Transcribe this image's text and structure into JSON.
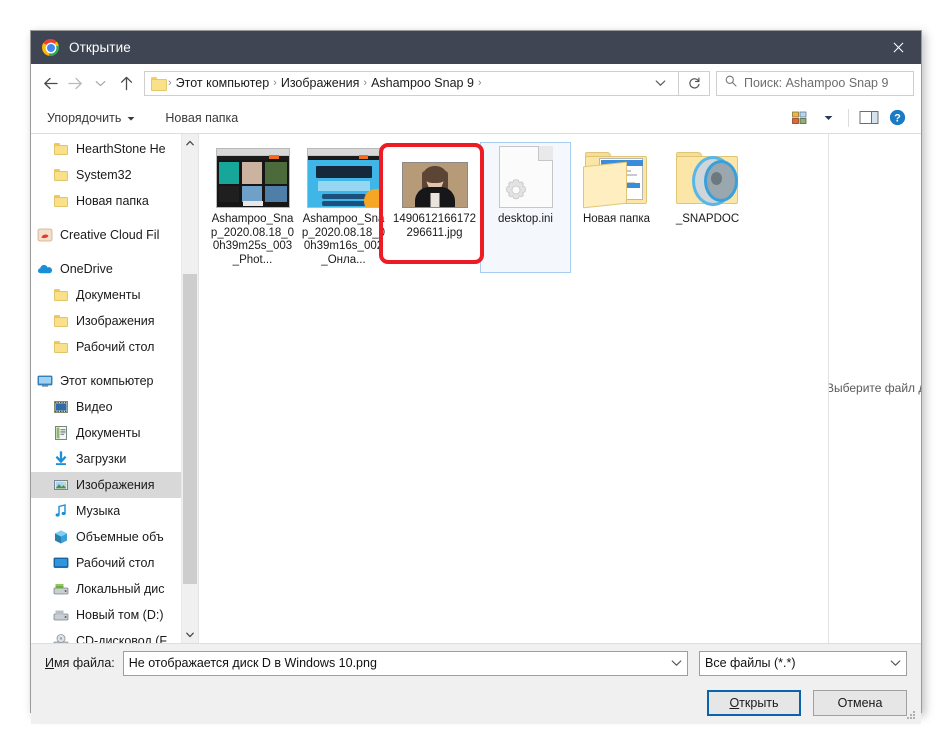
{
  "window": {
    "title": "Открытие",
    "title_icon": "chrome-icon",
    "close_icon": "close-icon"
  },
  "nav": {
    "back_icon": "arrow-left-icon",
    "forward_icon": "arrow-right-icon",
    "history_icon": "chevron-down-icon",
    "up_icon": "arrow-up-icon",
    "refresh_icon": "refresh-icon",
    "breadcrumb_icon": "folder-icon",
    "breadcrumb": [
      "Этот компьютер",
      "Изображения",
      "Ashampoo Snap 9"
    ],
    "breadcrumb_caret": "chevron-down-icon",
    "separator": "›"
  },
  "search": {
    "icon": "search-icon",
    "placeholder": "Поиск: Ashampoo Snap 9",
    "value": ""
  },
  "toolbar": {
    "organize_label": "Упорядочить",
    "organize_caret": "chevron-down-icon",
    "new_folder_label": "Новая папка",
    "view_icon": "view-layout-icon",
    "view_caret": "chevron-down-icon",
    "preview_pane_icon": "preview-pane-icon",
    "help_icon": "help-icon"
  },
  "sidebar": {
    "items": [
      {
        "label": "HearthStone  He",
        "icon": "folder-icon",
        "indent": 1,
        "selected": false
      },
      {
        "label": "System32",
        "icon": "folder-icon",
        "indent": 1,
        "selected": false
      },
      {
        "label": "Новая папка",
        "icon": "folder-icon",
        "indent": 1,
        "selected": false
      },
      {
        "label": "Creative Cloud Fil",
        "icon": "creative-cloud-icon",
        "indent": 0,
        "selected": false
      },
      {
        "label": "OneDrive",
        "icon": "onedrive-cloud-icon",
        "indent": 0,
        "selected": false
      },
      {
        "label": "Документы",
        "icon": "folder-icon",
        "indent": 1,
        "selected": false
      },
      {
        "label": "Изображения",
        "icon": "folder-icon",
        "indent": 1,
        "selected": false
      },
      {
        "label": "Рабочий стол",
        "icon": "folder-icon",
        "indent": 1,
        "selected": false
      },
      {
        "label": "Этот компьютер",
        "icon": "this-pc-icon",
        "indent": 0,
        "selected": false
      },
      {
        "label": "Видео",
        "icon": "video-folder-icon",
        "indent": 1,
        "selected": false
      },
      {
        "label": "Документы",
        "icon": "documents-folder-icon",
        "indent": 1,
        "selected": false
      },
      {
        "label": "Загрузки",
        "icon": "downloads-icon",
        "indent": 1,
        "selected": false
      },
      {
        "label": "Изображения",
        "icon": "pictures-folder-icon",
        "indent": 1,
        "selected": true
      },
      {
        "label": "Музыка",
        "icon": "music-note-icon",
        "indent": 1,
        "selected": false
      },
      {
        "label": "Объемные объ",
        "icon": "3d-objects-icon",
        "indent": 1,
        "selected": false
      },
      {
        "label": "Рабочий стол",
        "icon": "desktop-icon",
        "indent": 1,
        "selected": false
      },
      {
        "label": "Локальный дис",
        "icon": "hard-drive-icon",
        "indent": 1,
        "selected": false
      },
      {
        "label": "Новый том (D:)",
        "icon": "hard-drive-icon",
        "indent": 1,
        "selected": false
      },
      {
        "label": "CD-дисковод (F",
        "icon": "cd-drive-icon",
        "indent": 1,
        "selected": false
      }
    ],
    "scroll_up_icon": "chevron-up-icon",
    "scroll_down_icon": "chevron-down-icon"
  },
  "files": [
    {
      "name": "Ashampoo_Snap_2020.08.18_00h39m25s_003_Phot...",
      "thumb": "screenshot-dark-thumbnail",
      "selected": false,
      "annotated": false
    },
    {
      "name": "Ashampoo_Snap_2020.08.18_00h39m16s_002_Онла...",
      "thumb": "screenshot-blue-thumbnail",
      "selected": false,
      "annotated": false
    },
    {
      "name": "1490612166172296611.jpg",
      "thumb": "portrait-photo-thumbnail",
      "selected": false,
      "annotated": true
    },
    {
      "name": "desktop.ini",
      "thumb": "ini-file-icon",
      "selected": true,
      "annotated": false
    },
    {
      "name": "Новая папка",
      "thumb": "folder-with-document-icon",
      "selected": false,
      "annotated": false
    },
    {
      "name": "_SNAPDOC",
      "thumb": "folder-snapdoc-icon",
      "selected": false,
      "annotated": false
    }
  ],
  "preview": {
    "text": "Выберите файл для предварительного просмотра."
  },
  "footer": {
    "filename_label_prefix": "И",
    "filename_label_rest": "мя файла:",
    "filename_value": "Не отображается диск D в Windows 10.png",
    "filename_caret": "chevron-down-icon",
    "filetype_value": "Все файлы (*.*)",
    "filetype_caret": "chevron-down-icon",
    "open_label_prefix": "О",
    "open_label_rest": "ткрыть",
    "cancel_label": "Отмена",
    "resize_grip_icon": "resize-grip-icon"
  },
  "annotation": {
    "color": "#ed1c24",
    "target": "1490612166172296611.jpg"
  },
  "colors": {
    "titlebar": "#3f4552",
    "accent": "#0a64ad",
    "selection": "#d8d8d8",
    "annotation_red": "#ed1c24"
  }
}
